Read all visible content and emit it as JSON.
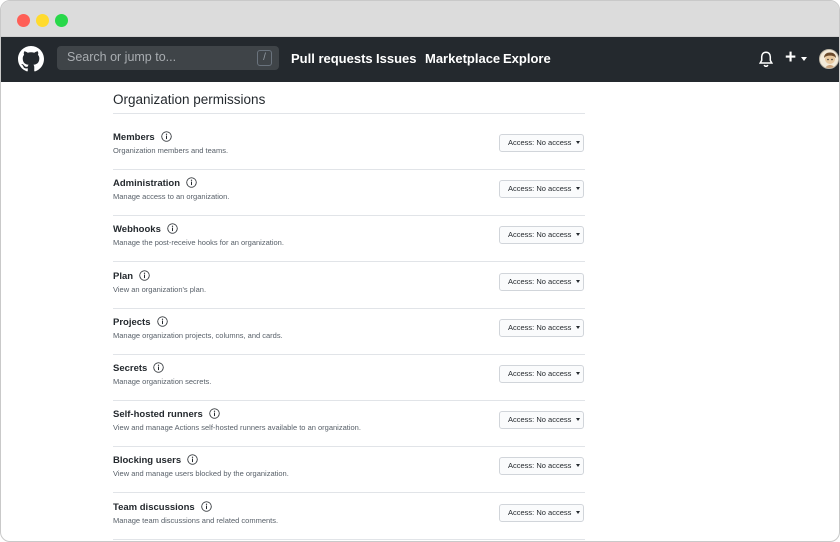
{
  "navbar": {
    "search_placeholder": "Search or jump to...",
    "search_shortcut": "/",
    "links": [
      "Pull requests",
      "Issues",
      "Marketplace",
      "Explore"
    ],
    "new_menu_glyph": "+"
  },
  "section": {
    "title": "Organization permissions"
  },
  "access_prefix": "Access:",
  "permissions": [
    {
      "name": "Members",
      "description": "Organization members and teams.",
      "access": "No access"
    },
    {
      "name": "Administration",
      "description": "Manage access to an organization.",
      "access": "No access"
    },
    {
      "name": "Webhooks",
      "description": "Manage the post-receive hooks for an organization.",
      "access": "No access"
    },
    {
      "name": "Plan",
      "description": "View an organization's plan.",
      "access": "No access"
    },
    {
      "name": "Projects",
      "description": "Manage organization projects, columns, and cards.",
      "access": "No access"
    },
    {
      "name": "Secrets",
      "description": "Manage organization secrets.",
      "access": "No access"
    },
    {
      "name": "Self-hosted runners",
      "description": "View and manage Actions self-hosted runners available to an organization.",
      "access": "No access"
    },
    {
      "name": "Blocking users",
      "description": "View and manage users blocked by the organization.",
      "access": "No access"
    },
    {
      "name": "Team discussions",
      "description": "Manage team discussions and related comments.",
      "access": "No access"
    }
  ],
  "icons": {
    "logo": "github-logo-icon",
    "info": "info-icon",
    "bell": "bell-icon",
    "caret": "caret-down-icon"
  },
  "colors": {
    "navbar": "#24292e",
    "titlebar": "#dcdcdc",
    "border": "#e1e4e8"
  }
}
